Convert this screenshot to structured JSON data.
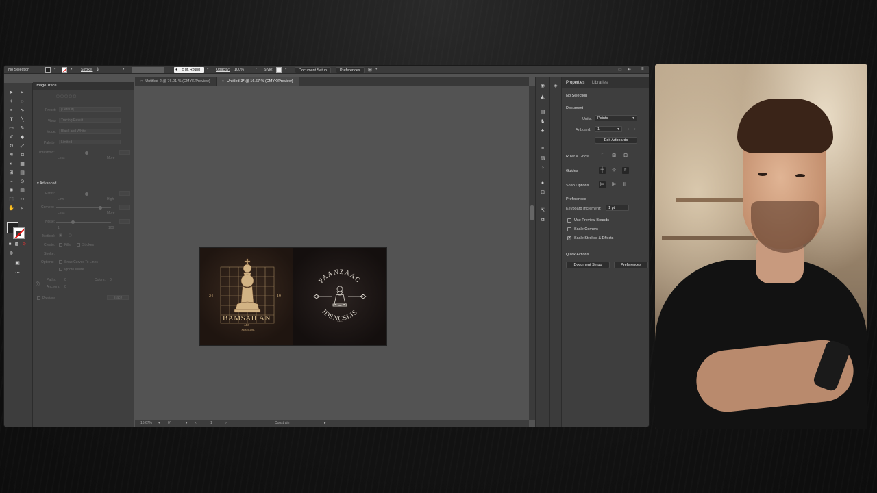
{
  "control_bar": {
    "selection": "No Selection",
    "stroke_label": "Stroke:",
    "brush": "5 pt. Round",
    "opacity_label": "Opacity:",
    "opacity_value": "100%",
    "style_label": "Style:",
    "document_setup": "Document Setup",
    "preferences": "Preferences"
  },
  "trace_panel": {
    "title": "Image Trace",
    "preset_label": "Preset:",
    "preset_value": "[Default]",
    "view_label": "View:",
    "view_value": "Tracing Result",
    "mode_label": "Mode:",
    "mode_value": "Black and White",
    "palette_label": "Palette:",
    "palette_value": "Limited",
    "threshold_label": "Threshold:",
    "less": "Less",
    "more": "More",
    "advanced": "Advanced",
    "paths_label": "Paths:",
    "low": "Low",
    "high": "High",
    "corners_label": "Corners:",
    "noise_label": "Noise:",
    "noise_min": "1",
    "noise_max": "100",
    "method_label": "Method:",
    "create_label": "Create:",
    "fills": "Fills",
    "strokes": "Strokes",
    "stroke_label": "Stroke:",
    "options_label": "Options:",
    "snap_curves": "Snap Curves To Lines",
    "ignore_white": "Ignore White",
    "paths_count_label": "Paths:",
    "paths_count": "0",
    "colors_label": "Colors:",
    "colors_count": "0",
    "anchors_label": "Anchors:",
    "anchors_count": "0",
    "preview": "Preview",
    "trace_button": "Trace"
  },
  "doc_tabs": [
    {
      "label": "Untitled-2 @ 76.01 % (CMYK/Preview)"
    },
    {
      "label": "Untitled-3* @ 16.67 % (CMYK/Preview)"
    }
  ],
  "status_bar": {
    "zoom": "16.67%",
    "rotation": "0°",
    "artboard": "1",
    "constrain": "Constrain"
  },
  "artwork": {
    "left_logo_text": "BAMSAILAN",
    "left_number_left": "24",
    "left_number_right": "19",
    "left_small_text": "ABB",
    "left_small_text2": "SIMSCLSE",
    "right_top_text": "PAANZAAG",
    "right_bottom_text": "IDSNCSLIS",
    "right_small_text": "LLL"
  },
  "properties": {
    "tab_properties": "Properties",
    "tab_libraries": "Libraries",
    "no_selection": "No Selection",
    "document": "Document",
    "units_label": "Units:",
    "units_value": "Points",
    "artboard_label": "Artboard:",
    "artboard_value": "1",
    "edit_artboards": "Edit Artboards",
    "ruler_grids": "Ruler & Grids",
    "guides": "Guides",
    "snap_options": "Snap Options",
    "preferences_head": "Preferences",
    "keyboard_increment_label": "Keyboard Increment:",
    "keyboard_increment_value": "1 pt",
    "use_preview_bounds": "Use Preview Bounds",
    "scale_corners": "Scale Corners",
    "scale_strokes": "Scale Strokes & Effects",
    "quick_actions": "Quick Actions",
    "document_setup": "Document Setup",
    "preferences": "Preferences"
  },
  "colors": {
    "app_bg": "#535353",
    "panel_bg": "#3e3e3e",
    "artboard_bg": "#1e1613",
    "gold": "#c9a877"
  }
}
